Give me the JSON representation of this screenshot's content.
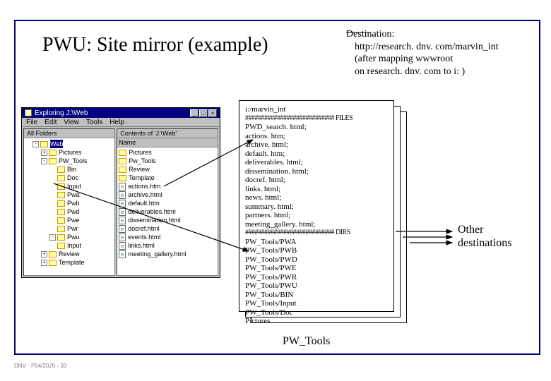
{
  "title": "PWU: Site mirror (example)",
  "destination": {
    "label": "Destination:",
    "url": "http://research. dnv. com/marvin_int",
    "note1": "(after mapping wwwroot",
    "note2": "on research. dnv. com to i: )"
  },
  "explorer": {
    "title": "Exploring   J:\\Web",
    "menus": [
      "File",
      "Edit",
      "View",
      "Tools",
      "Help"
    ],
    "left_header": "All Folders",
    "right_header": "Contents of 'J:\\Web'",
    "tree": [
      {
        "level": 1,
        "expander": "-",
        "name": "Web",
        "selected": true
      },
      {
        "level": 2,
        "expander": "+",
        "name": "Pictures"
      },
      {
        "level": 2,
        "expander": "-",
        "name": "PW_Tools"
      },
      {
        "level": 3,
        "expander": "",
        "name": "Bin"
      },
      {
        "level": 3,
        "expander": "",
        "name": "Doc"
      },
      {
        "level": 3,
        "expander": "",
        "name": "Input"
      },
      {
        "level": 3,
        "expander": "",
        "name": "Pwa"
      },
      {
        "level": 3,
        "expander": "",
        "name": "Pwb"
      },
      {
        "level": 3,
        "expander": "",
        "name": "Pwd"
      },
      {
        "level": 3,
        "expander": "",
        "name": "Pwe"
      },
      {
        "level": 3,
        "expander": "",
        "name": "Pwr"
      },
      {
        "level": 3,
        "expander": "-",
        "name": "Pwu"
      },
      {
        "level": 3,
        "expander": "",
        "name": "Input"
      },
      {
        "level": 2,
        "expander": "+",
        "name": "Review"
      },
      {
        "level": 2,
        "expander": "+",
        "name": "Template"
      }
    ],
    "files": [
      {
        "type": "folder",
        "name": "Pictures"
      },
      {
        "type": "folder",
        "name": "Pw_Tools"
      },
      {
        "type": "folder",
        "name": "Review"
      },
      {
        "type": "folder",
        "name": "Template"
      },
      {
        "type": "html",
        "name": "actions.htm"
      },
      {
        "type": "html",
        "name": "archive.html"
      },
      {
        "type": "html",
        "name": "default.htm"
      },
      {
        "type": "html",
        "name": "deliverables.html"
      },
      {
        "type": "html",
        "name": "dissemination.html"
      },
      {
        "type": "html",
        "name": "docref.html"
      },
      {
        "type": "html",
        "name": "events.html"
      },
      {
        "type": "html",
        "name": "links.html"
      },
      {
        "type": "html",
        "name": "meeting_gallery.html"
      }
    ]
  },
  "document": {
    "header": "i:/marvin_int",
    "files_marker": "############################ FILES",
    "files": [
      "PWD_search. html;",
      "actions. htm;",
      "archive. html;",
      "default. htm;",
      "deliverables. html;",
      "dissemination. html;",
      "docref. html;",
      "links. html;",
      "news. html;",
      "summary. html;",
      "partners. html;",
      "meeting_gallery. html;"
    ],
    "dirs_marker": "############################ DIRS",
    "dirs": [
      "PW_Tools/PWA",
      "PW_Tools/PWB",
      "PW_Tools/PWD",
      "PW_Tools/PWE",
      "PW_Tools/PWR",
      "PW_Tools/PWU",
      "PW_Tools/BIN",
      "PW_Tools/Input",
      "PW_Tools/Doc",
      "Pictures"
    ]
  },
  "pw_tools_label": "PW_Tools",
  "other_dest_line1": "Other",
  "other_dest_line2": "destinations",
  "footer": "DNV - P04/2020 - 33"
}
